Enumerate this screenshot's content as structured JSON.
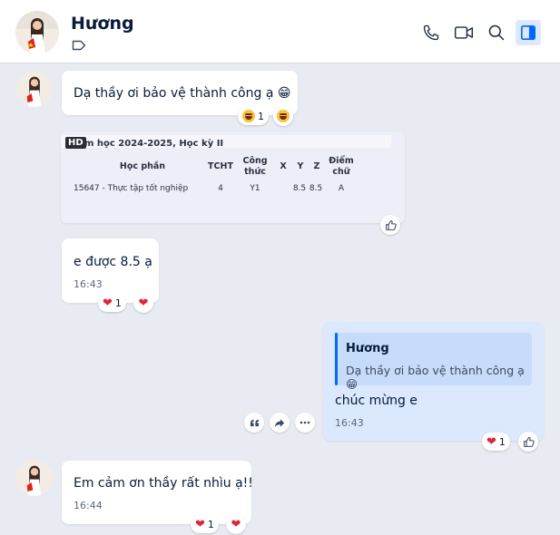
{
  "header": {
    "contact_name": "Hương"
  },
  "messages": {
    "m1": {
      "text": "Dạ thầy ơi bảo vệ thành công ạ 😁",
      "reaction_count": "1"
    },
    "image": {
      "badge": "HD",
      "caption": "m học 2024-2025, Học kỳ II",
      "headers": [
        "Học phần",
        "TCHT",
        "Công thức",
        "X",
        "Y",
        "Z",
        "Điểm chữ"
      ],
      "row": [
        "15647 - Thực tập tốt nghiệp",
        "4",
        "Y1",
        "",
        "8.5",
        "8.5",
        "A"
      ]
    },
    "m2": {
      "text": "e được 8.5 ạ",
      "time": "16:43",
      "reaction_count": "1"
    },
    "m3": {
      "quote_name": "Hương",
      "quote_text": "Dạ thầy ơi bảo vệ thành công ạ 😁",
      "text": "chúc mừng e",
      "time": "16:43",
      "reaction_count": "1"
    },
    "m4": {
      "text": "Em cảm ơn thầy rất nhìu ạ!!",
      "time": "16:44",
      "reaction_count": "1"
    }
  },
  "colors": {
    "accent": "#0068ff",
    "my_bubble": "#dbe8fe",
    "background": "#e8ebf1",
    "heart": "#e0243c"
  },
  "icons": [
    "phone-icon",
    "video-call-icon",
    "search-icon",
    "sidebar-toggle-icon",
    "tag-icon",
    "like-icon",
    "quote-icon",
    "forward-icon",
    "more-icon"
  ]
}
